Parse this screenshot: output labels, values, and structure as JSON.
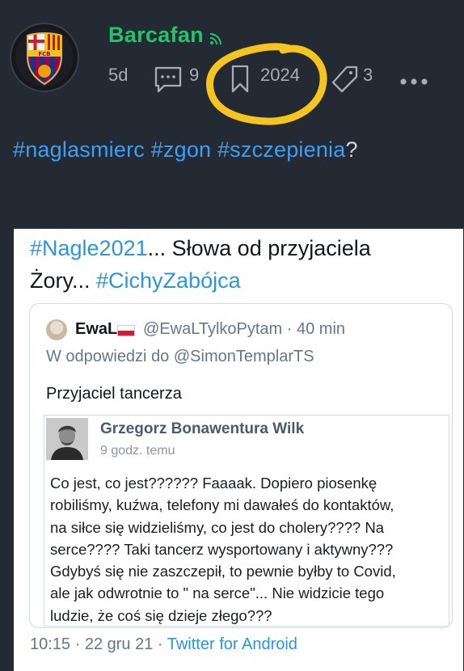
{
  "post": {
    "author": "Barcafan",
    "avatar_icon": "fc-barcelona-crest-icon",
    "avatar_text": "FCB",
    "age": "5d",
    "comments_count": "9",
    "bookmarks_count": "2024",
    "shares_count": "3",
    "hashtags": [
      "#naglasmierc",
      "#zgon",
      "#szczepienia"
    ],
    "hashtag_suffix": "?"
  },
  "colors": {
    "background": "#242a33",
    "username": "#21c46a",
    "hashtag": "#3f9ef0",
    "highlight_circle": "#f5c51e",
    "twitter_link": "#2a97d8"
  },
  "embedded_tweet": {
    "line1_tag": "#Nagle2021",
    "line1_text": "... Słowa od przyjaciela",
    "line2_text": "Żory... ",
    "line2_tag": "#CichyZabójca",
    "timestamp": "10:15 · 22 gru 21 · ",
    "client": "Twitter for Android",
    "quote": {
      "name": "EwaL",
      "flag_icon": "poland-flag-icon",
      "handle": "@EwaLTylkoPytam · 40 min",
      "reply_prefix": "W odpowiedzi do ",
      "reply_to": "@SimonTemplarTS",
      "body": "Przyjaciel tancerza",
      "facebook_post": {
        "author": "Grzegorz Bonawentura Wilk",
        "time": "9 godz. temu",
        "lines": [
          "Co jest, co jest?????? Faaaak. Dopiero piosenkę",
          "robiliśmy, kuźwa, telefony mi dawałeś do kontaktów,",
          "na siłce się widzieliśmy, co jest do cholery???? Na",
          "serce???? Taki tancerz wysportowany i aktywny???",
          "Gdybyś się nie zaszczepił, to pewnie byłby to Covid,",
          "ale jak odwrotnie to \" na serce\"... Nie widzicie tego",
          "ludzie, że coś się dzieje złego???"
        ]
      }
    }
  }
}
